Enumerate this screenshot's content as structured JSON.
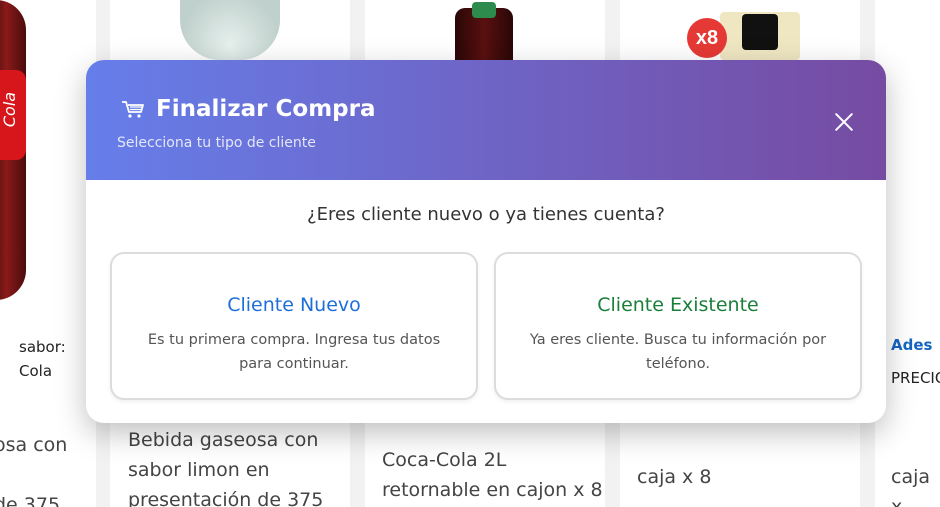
{
  "background": {
    "col0": {
      "text_lines": [
        "sabor:",
        "Cola"
      ],
      "desc_lines": [
        "osa con",
        "de 375"
      ]
    },
    "col1": {
      "desc_lines": [
        "Bebida gaseosa con",
        "sabor limon en",
        "presentación de 375"
      ]
    },
    "col2": {
      "desc_lines": [
        "Coca-Cola 2L",
        "retornable en cajon x 8"
      ]
    },
    "col3": {
      "badge": "x8",
      "desc_lines": [
        "caja x 8"
      ]
    },
    "col4": {
      "link": "Ades",
      "label": "PRECIO",
      "desc_lines": [
        "caja x"
      ]
    },
    "label_text": "Cola"
  },
  "modal": {
    "title": "Finalizar Compra",
    "subtitle": "Selecciona tu tipo de cliente",
    "question": "¿Eres cliente nuevo o ya tienes cuenta?",
    "options": [
      {
        "title": "Cliente Nuevo",
        "description": "Es tu primera compra. Ingresa tus datos para continuar."
      },
      {
        "title": "Cliente Existente",
        "description": "Ya eres cliente. Busca tu información por teléfono."
      }
    ],
    "colors": {
      "header_start": "#667eea",
      "header_end": "#764ba2",
      "new_title": "#1e6fd9",
      "existing_title": "#1b7f3a"
    },
    "icons": {
      "title_icon": "cart-icon",
      "close_icon": "close-icon"
    }
  }
}
